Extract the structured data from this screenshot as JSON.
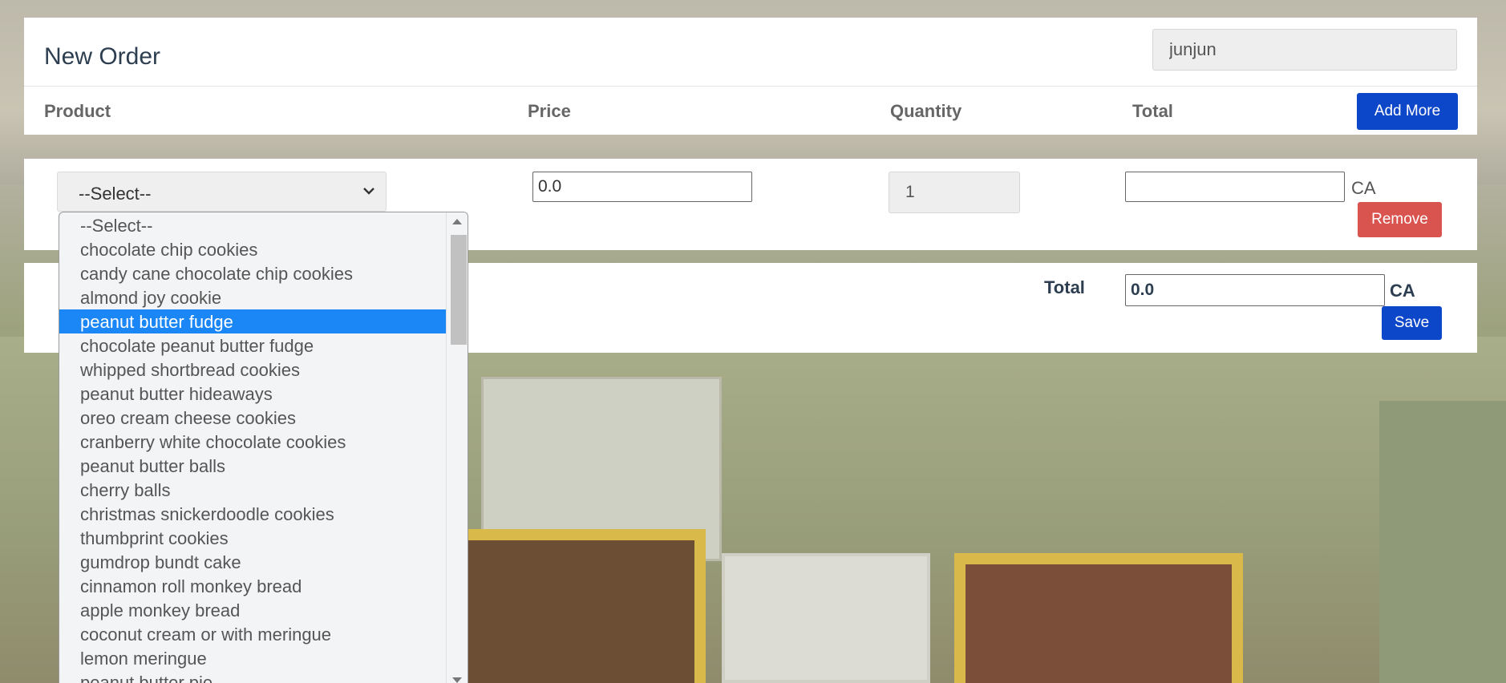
{
  "header": {
    "title": "New Order",
    "user_value": "junjun",
    "columns": [
      "Product",
      "Price",
      "Quantity",
      "Total"
    ],
    "add_more_label": "Add More"
  },
  "order_row": {
    "product_selected": "--Select--",
    "price_value": "0.0",
    "quantity_value": "1",
    "line_total_value": "",
    "currency": "CA",
    "remove_label": "Remove"
  },
  "summary": {
    "total_label": "Total",
    "total_value": "0.0",
    "currency": "CA",
    "save_label": "Save"
  },
  "dropdown": {
    "highlighted_index": 4,
    "options": [
      "--Select--",
      "chocolate chip cookies",
      "candy cane chocolate chip cookies",
      "almond joy cookie",
      "peanut butter fudge",
      "chocolate peanut butter fudge",
      "whipped shortbread cookies",
      "peanut butter hideaways",
      "oreo cream cheese cookies",
      "cranberry white chocolate cookies",
      "peanut butter balls",
      "cherry balls",
      "christmas snickerdoodle cookies",
      "thumbprint cookies",
      "gumdrop bundt cake",
      "cinnamon roll monkey bread",
      "apple monkey bread",
      "coconut cream or with meringue",
      "lemon meringue",
      "peanut butter pie"
    ]
  }
}
